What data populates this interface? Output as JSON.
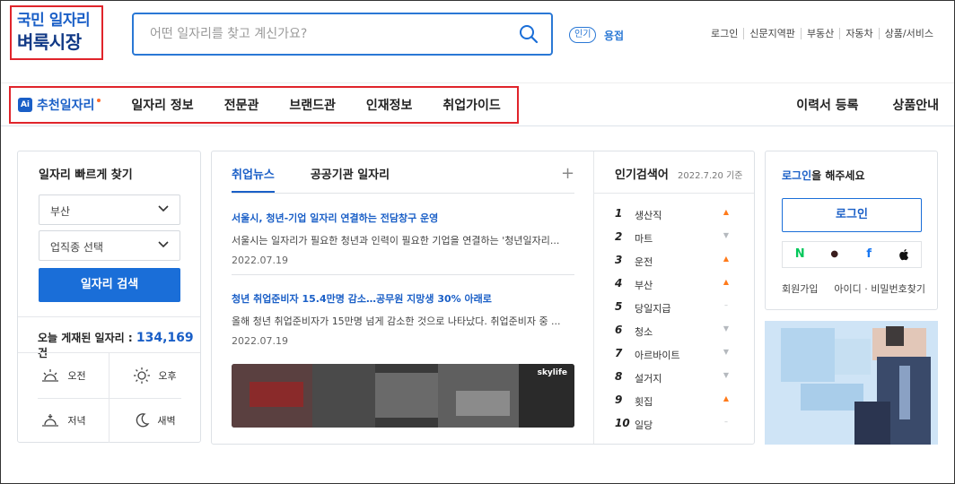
{
  "logo": {
    "line1": "국민 일자리",
    "line2": "벼룩시장"
  },
  "search": {
    "placeholder": "어떤 일자리를 찾고 계신가요?"
  },
  "popular": {
    "badge": "인기",
    "keyword": "용접"
  },
  "util_links": [
    "로그인",
    "신문지역판",
    "부동산",
    "자동차",
    "상품/서비스"
  ],
  "nav": {
    "ai_badge": "Ai",
    "ai_label": "추천일자리",
    "items": [
      "일자리 정보",
      "전문관",
      "브랜드관",
      "인재정보",
      "취업가이드"
    ],
    "right": [
      "이력서 등록",
      "상품안내"
    ]
  },
  "quick": {
    "title": "일자리 빠르게 찾기",
    "region": "부산",
    "job_type": "업직종 선택",
    "search_button": "일자리 검색",
    "today_label": "오늘 게재된 일자리 :",
    "today_count": "134,169",
    "today_unit": "건",
    "times": [
      "오전",
      "오후",
      "저녁",
      "새벽"
    ]
  },
  "news": {
    "tabs": [
      "취업뉴스",
      "공공기관 일자리"
    ],
    "plus": "+",
    "articles": [
      {
        "headline": "서울시, 청년-기업 일자리 연결하는 전담창구 운영",
        "body": "서울시는 일자리가 필요한 청년과 인력이 필요한 기업을 연결하는 '청년일자리...",
        "date": "2022.07.19"
      },
      {
        "headline": "청년 취업준비자 15.4만명 감소…공무원 지망생 30% 아래로",
        "body": "올해 청년 취업준비자가 15만명 넘게 감소한 것으로 나타났다. 취업준비자 중 ...",
        "date": "2022.07.19"
      }
    ],
    "video_brand": "skylife"
  },
  "ranking": {
    "title": "인기검색어",
    "date": "2022.7.20 기준",
    "items": [
      {
        "rank": "1",
        "word": "생산직",
        "trend": "up"
      },
      {
        "rank": "2",
        "word": "마트",
        "trend": "down"
      },
      {
        "rank": "3",
        "word": "운전",
        "trend": "up"
      },
      {
        "rank": "4",
        "word": "부산",
        "trend": "up"
      },
      {
        "rank": "5",
        "word": "당일지급",
        "trend": "same"
      },
      {
        "rank": "6",
        "word": "청소",
        "trend": "down"
      },
      {
        "rank": "7",
        "word": "아르바이트",
        "trend": "down"
      },
      {
        "rank": "8",
        "word": "설거지",
        "trend": "down"
      },
      {
        "rank": "9",
        "word": "횟집",
        "trend": "up"
      },
      {
        "rank": "10",
        "word": "일당",
        "trend": "same"
      }
    ]
  },
  "login": {
    "title_link": "로그인",
    "title_rest": "을 해주세요",
    "button": "로그인",
    "social": [
      "N",
      "●",
      "f",
      ""
    ],
    "signup": "회원가입",
    "find": "아이디 · 비밀번호찾기"
  },
  "colors": {
    "accent": "#1a6ed8",
    "brand_dark": "#123a86",
    "highlight_box": "#e0242b",
    "trend_up": "#ff7a1a",
    "trend_down": "#b5b9be"
  }
}
